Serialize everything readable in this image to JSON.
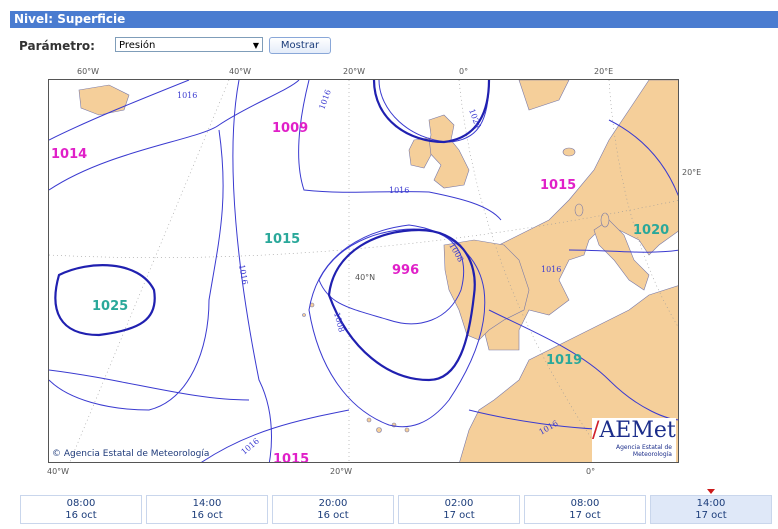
{
  "header": {
    "title": "Nivel: Superficie"
  },
  "controls": {
    "param_label": "Parámetro:",
    "select_value": "Presión",
    "show_button": "Mostrar"
  },
  "map": {
    "top_ticks": [
      "60°W",
      "40°W",
      "20°W",
      "0°",
      "20°E"
    ],
    "bottom_ticks": [
      "40°W",
      "20°W",
      "0°"
    ],
    "right_tick": "20°E",
    "lat_label": "40°N",
    "pressure_labels": {
      "p1014": "1014",
      "p1009": "1009",
      "p1015a": "1015",
      "p1015b": "1015",
      "p1015c": "1015",
      "p1025": "1025",
      "p996": "996",
      "p1019": "1019",
      "p1020": "1020"
    },
    "isobar_labels": {
      "i1016a": "1016",
      "i1016b": "1016",
      "i1016c": "1016",
      "i1016d": "1016",
      "i1016e": "1016",
      "i1016f": "1016",
      "i1016g": "1016",
      "i1008a": "1008",
      "i1008b": "1008",
      "i1024": "1024"
    },
    "credit": "Agencia Estatal de Meteorología",
    "logo_text": "AEMet",
    "logo_subtitle": "Agencia Estatal de Meteorología"
  },
  "colors": {
    "magenta": "#e020c8",
    "teal": "#2aa89a",
    "isobar": "#3a3ad0",
    "land": "#f5cf9a"
  },
  "timeline": [
    {
      "time": "08:00",
      "date": "16 oct"
    },
    {
      "time": "14:00",
      "date": "16 oct"
    },
    {
      "time": "20:00",
      "date": "16 oct"
    },
    {
      "time": "02:00",
      "date": "17 oct"
    },
    {
      "time": "08:00",
      "date": "17 oct"
    },
    {
      "time": "14:00",
      "date": "17 oct",
      "active": true
    }
  ]
}
